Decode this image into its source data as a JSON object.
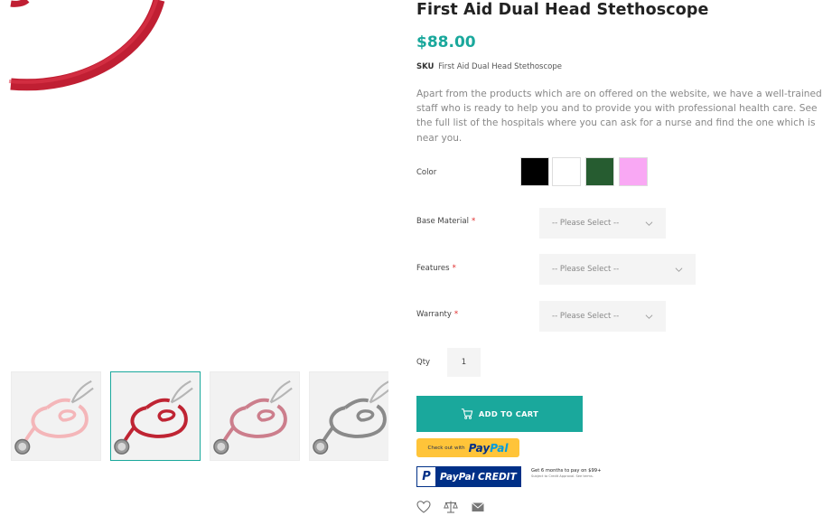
{
  "product": {
    "title": "First Aid Dual Head Stethoscope",
    "price": "$88.00",
    "sku_label": "SKU",
    "sku_value": "First Aid Dual Head Stethoscope",
    "description": "Apart from the products which are on offered on the website, we have a well-trained staff who is ready to help you and to provide you with professional health care. See the full list of the hospitals where you can ask for a nurse and find the one which is near you."
  },
  "gallery": {
    "main_color": "#cc2237",
    "thumbnails": [
      {
        "tube_color": "#f4b6b9",
        "active": false
      },
      {
        "tube_color": "#bf2433",
        "active": true
      },
      {
        "tube_color": "#cc7e8c",
        "active": false
      },
      {
        "tube_color": "#8a8a8a",
        "active": false
      }
    ]
  },
  "options": {
    "color_label": "Color",
    "colors": [
      "#000000",
      "#ffffff",
      "#265c30",
      "#f9a8f4"
    ],
    "base_material": {
      "label": "Base Material",
      "placeholder": "-- Please Select --"
    },
    "features": {
      "label": "Features",
      "placeholder": "-- Please Select --"
    },
    "warranty": {
      "label": "Warranty",
      "placeholder": "-- Please Select --"
    },
    "required_mark": "*",
    "qty_label": "Qty",
    "qty_value": "1"
  },
  "buttons": {
    "add_to_cart": "ADD TO CART",
    "paypal_checkout_small": "Check out with",
    "paypal_logo_pay": "Pay",
    "paypal_logo_pal": "Pal",
    "paypal_credit_p": "P",
    "paypal_credit": "PayPal CREDIT",
    "paypal_credit_note": "Get 6 months to pay on $99+",
    "paypal_credit_subnote": "Subject to Credit Approval. See terms."
  },
  "icons": {
    "wishlist": "heart-icon",
    "compare": "scales-icon",
    "email": "envelope-icon"
  },
  "colors": {
    "accent": "#1aa89c",
    "paypal_yellow": "#ffc439",
    "paypal_navy": "#003087"
  }
}
